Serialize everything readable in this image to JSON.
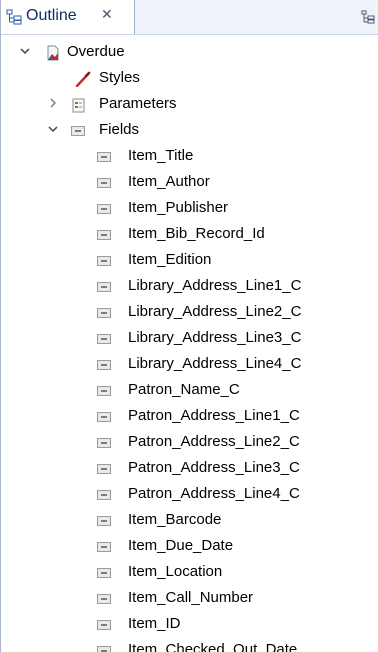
{
  "tab": {
    "label": "Outline",
    "close": "✕"
  },
  "tree": {
    "root": "Overdue",
    "styles": "Styles",
    "parameters": "Parameters",
    "fields": "Fields",
    "field_items": [
      "Item_Title",
      "Item_Author",
      "Item_Publisher",
      "Item_Bib_Record_Id",
      "Item_Edition",
      "Library_Address_Line1_C",
      "Library_Address_Line2_C",
      "Library_Address_Line3_C",
      "Library_Address_Line4_C",
      "Patron_Name_C",
      "Patron_Address_Line1_C",
      "Patron_Address_Line2_C",
      "Patron_Address_Line3_C",
      "Patron_Address_Line4_C",
      "Item_Barcode",
      "Item_Due_Date",
      "Item_Location",
      "Item_Call_Number",
      "Item_ID",
      "Item_Checked_Out_Date"
    ]
  },
  "colors": {
    "tab_text": "#0b2e66",
    "tab_border": "#9fb1cc",
    "strip_bg": "#eef3fa"
  }
}
